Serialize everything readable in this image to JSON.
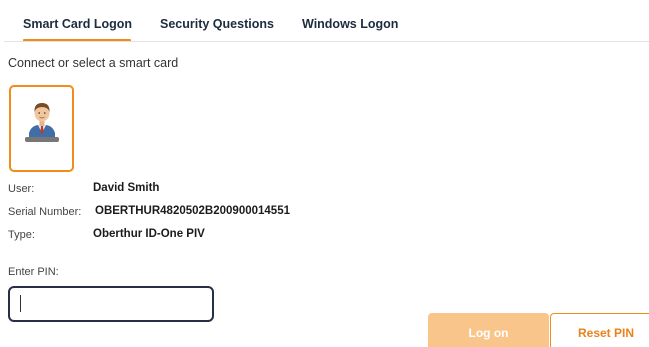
{
  "tabs": {
    "smart_card": "Smart Card Logon",
    "security_questions": "Security Questions",
    "windows_logon": "Windows Logon",
    "active": "Smart Card Logon"
  },
  "prompt": "Connect or select a smart card",
  "card": {
    "icon": "user-avatar-icon"
  },
  "info": {
    "user_label": "User:",
    "user_value": "David Smith",
    "serial_label": "Serial Number:",
    "serial_value": "OBERTHUR4820502B200900014551",
    "type_label": "Type:",
    "type_value": "Oberthur ID-One PIV"
  },
  "pin": {
    "label": "Enter PIN:",
    "value": ""
  },
  "buttons": {
    "logon": "Log on",
    "reset_pin": "Reset PIN"
  },
  "colors": {
    "accent": "#f08c1a",
    "logon_disabled": "#f9c58a",
    "input_border": "#253045"
  }
}
